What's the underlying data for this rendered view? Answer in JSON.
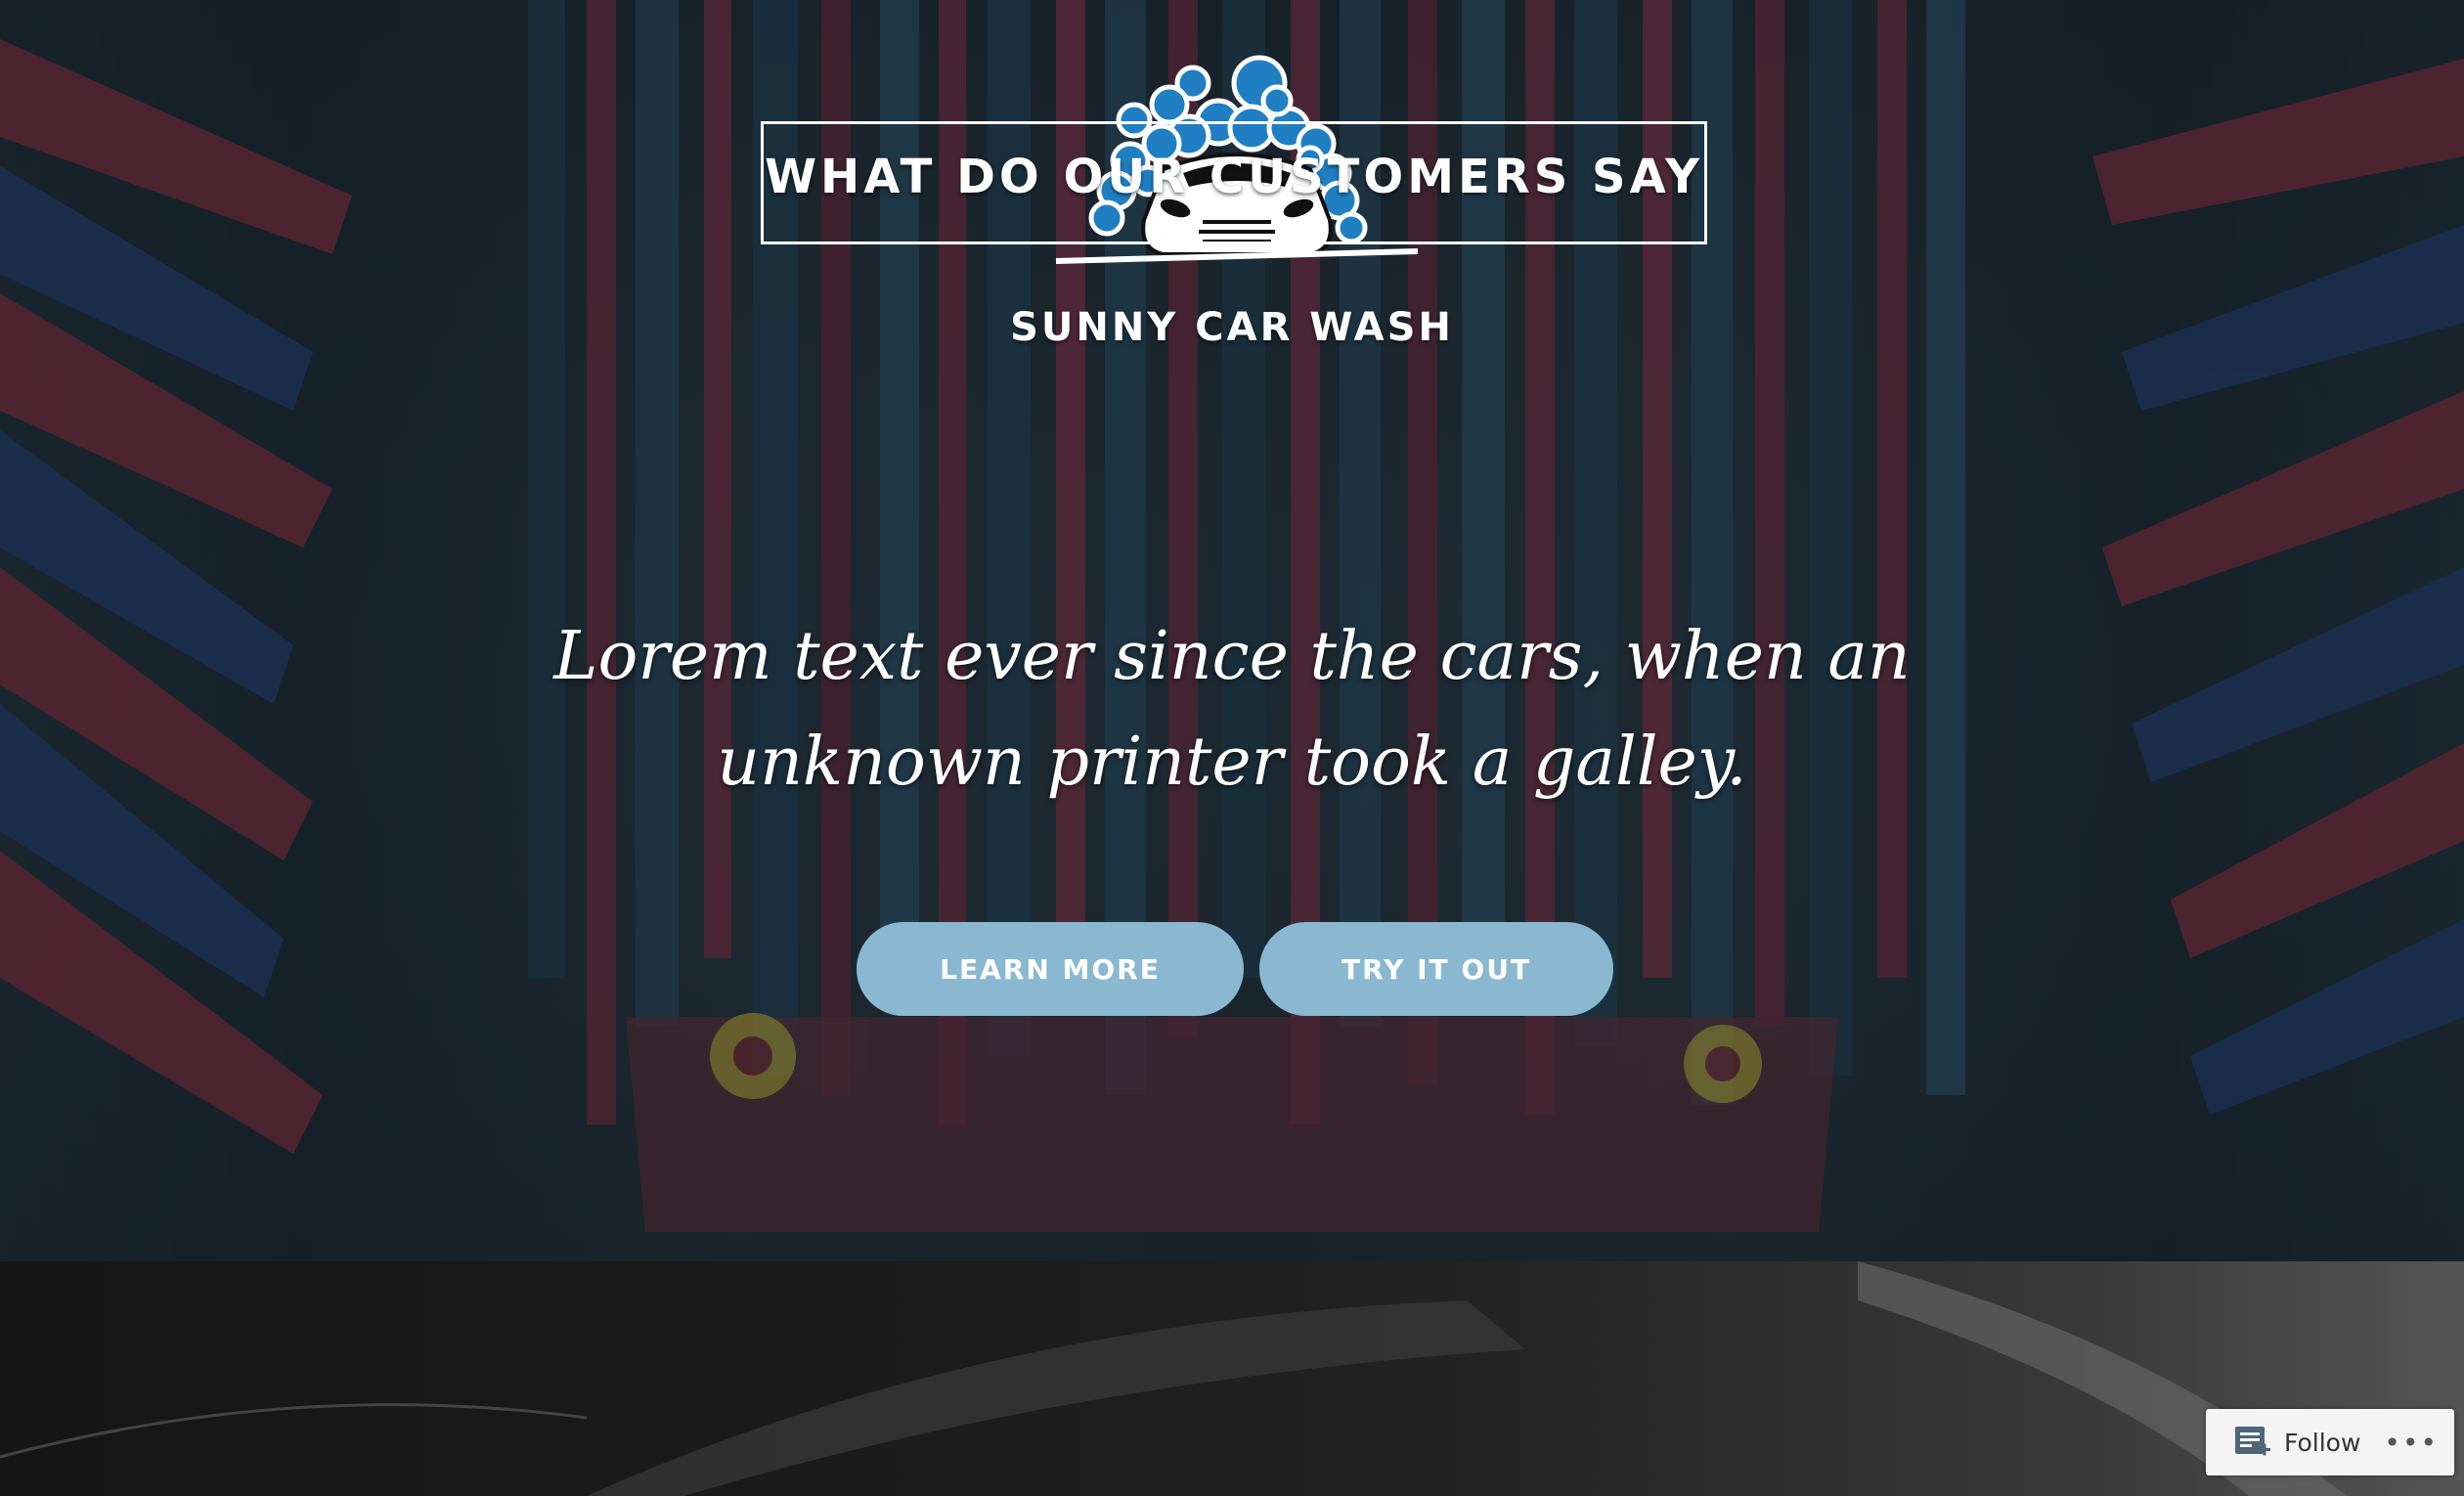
{
  "site": {
    "title": "SUNNY CAR WASH",
    "logo_icon": "car-wash-bubbles-logo"
  },
  "hero": {
    "tagline_line1": "Lorem text ever since the cars, when an",
    "tagline_line2": "unknown printer took a galley.",
    "buttons": {
      "learn_more": "LEARN MORE",
      "try_it_out": "TRY IT OUT"
    }
  },
  "testimonials": {
    "heading": "WHAT DO OUR CUSTOMERS SAY"
  },
  "follow_widget": {
    "label": "Follow",
    "more": "•••",
    "icon": "reader-follow-icon"
  },
  "colors": {
    "button_bg": "#8ab8d0",
    "logo_bubble": "#1f7fc2",
    "text": "#ffffff"
  }
}
